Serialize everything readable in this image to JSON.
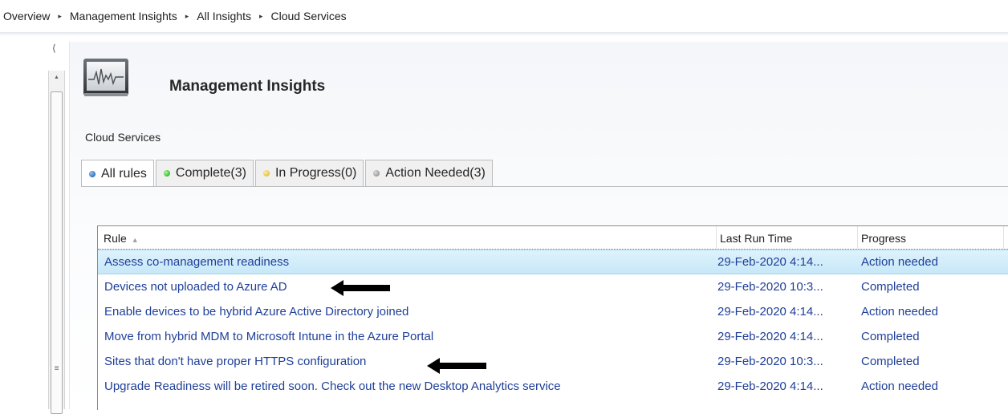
{
  "breadcrumb": {
    "items": [
      "Overview",
      "Management Insights",
      "All Insights",
      "Cloud Services"
    ],
    "separator": "▸"
  },
  "header": {
    "title": "Management Insights",
    "subtitle": "Cloud Services"
  },
  "tabs": [
    {
      "label": "All rules",
      "dot_color": "#2f6fb8",
      "active": true
    },
    {
      "label": "Complete(3)",
      "dot_color": "#35c02a",
      "active": false
    },
    {
      "label": "In Progress(0)",
      "dot_color": "#e8c33a",
      "active": false
    },
    {
      "label": "Action Needed(3)",
      "dot_color": "#9a9a9a",
      "active": false
    }
  ],
  "table": {
    "columns": [
      "Rule",
      "Last Run Time",
      "Progress"
    ],
    "rows": [
      {
        "rule": "Assess co-management readiness",
        "last_run": "29-Feb-2020 4:14...",
        "progress": "Action needed",
        "selected": true
      },
      {
        "rule": "Devices not uploaded to Azure AD",
        "last_run": "29-Feb-2020 10:3...",
        "progress": "Completed"
      },
      {
        "rule": "Enable devices to be hybrid Azure Active Directory joined",
        "last_run": "29-Feb-2020 4:14...",
        "progress": "Action needed"
      },
      {
        "rule": "Move from hybrid MDM to Microsoft Intune in the Azure Portal",
        "last_run": "29-Feb-2020 4:14...",
        "progress": "Completed"
      },
      {
        "rule": "Sites that don't have proper HTTPS configuration",
        "last_run": "29-Feb-2020 10:3...",
        "progress": "Completed"
      },
      {
        "rule": "Upgrade Readiness will be retired soon. Check out the new Desktop Analytics service",
        "last_run": "29-Feb-2020 4:14...",
        "progress": "Action needed"
      }
    ]
  },
  "colors": {
    "link_text": "#1f3f99",
    "selection": "#c7e8f8"
  }
}
